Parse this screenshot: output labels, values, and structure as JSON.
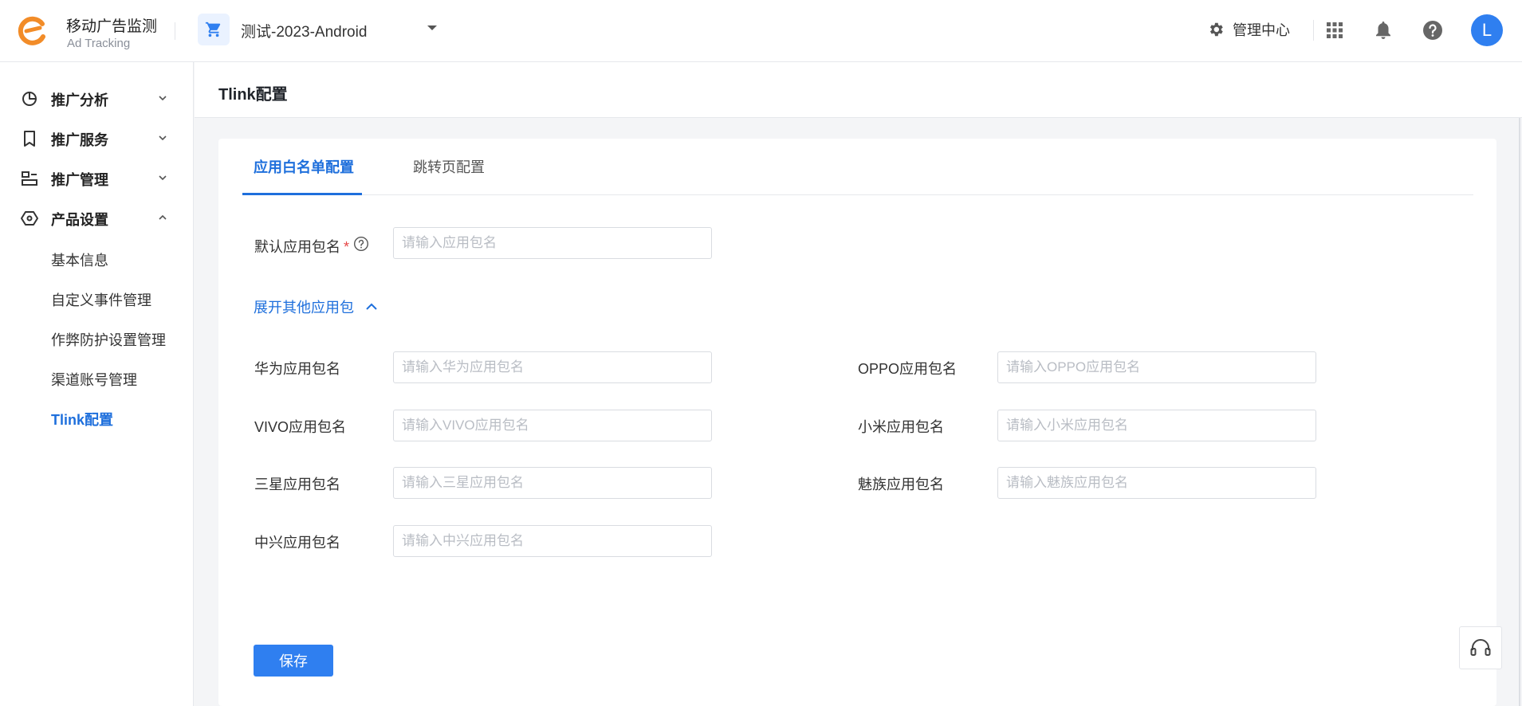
{
  "header": {
    "brand_title": "移动广告监测",
    "brand_subtitle": "Ad Tracking",
    "app_name": "测试-2023-Android",
    "admin_label": "管理中心",
    "avatar_letter": "L"
  },
  "sidebar": {
    "groups": [
      {
        "label": "推广分析",
        "icon": "analysis-icon",
        "expanded": false
      },
      {
        "label": "推广服务",
        "icon": "bookmark-icon",
        "expanded": false
      },
      {
        "label": "推广管理",
        "icon": "manage-icon",
        "expanded": false
      },
      {
        "label": "产品设置",
        "icon": "settings-hexagon-icon",
        "expanded": true
      }
    ],
    "sub_items": [
      "基本信息",
      "自定义事件管理",
      "作弊防护设置管理",
      "渠道账号管理",
      "Tlink配置"
    ],
    "active_sub_item": "Tlink配置"
  },
  "page": {
    "title": "Tlink配置"
  },
  "tabs": {
    "items": [
      "应用白名单配置",
      "跳转页配置"
    ],
    "active": "应用白名单配置"
  },
  "form": {
    "default_package": {
      "label": "默认应用包名",
      "required_mark": "*",
      "placeholder": "请输入应用包名",
      "value": ""
    },
    "expand_label": "展开其他应用包",
    "fields": [
      {
        "label": "华为应用包名",
        "placeholder": "请输入华为应用包名",
        "value": ""
      },
      {
        "label": "OPPO应用包名",
        "placeholder": "请输入OPPO应用包名",
        "value": ""
      },
      {
        "label": "VIVO应用包名",
        "placeholder": "请输入VIVO应用包名",
        "value": ""
      },
      {
        "label": "小米应用包名",
        "placeholder": "请输入小米应用包名",
        "value": ""
      },
      {
        "label": "三星应用包名",
        "placeholder": "请输入三星应用包名",
        "value": ""
      },
      {
        "label": "魅族应用包名",
        "placeholder": "请输入魅族应用包名",
        "value": ""
      },
      {
        "label": "中兴应用包名",
        "placeholder": "请输入中兴应用包名",
        "value": ""
      }
    ],
    "save_label": "保存"
  },
  "colors": {
    "accent": "#2f7ff0",
    "active_text": "#1e6fdc",
    "required": "#e64545",
    "logo": "#f28c28"
  }
}
